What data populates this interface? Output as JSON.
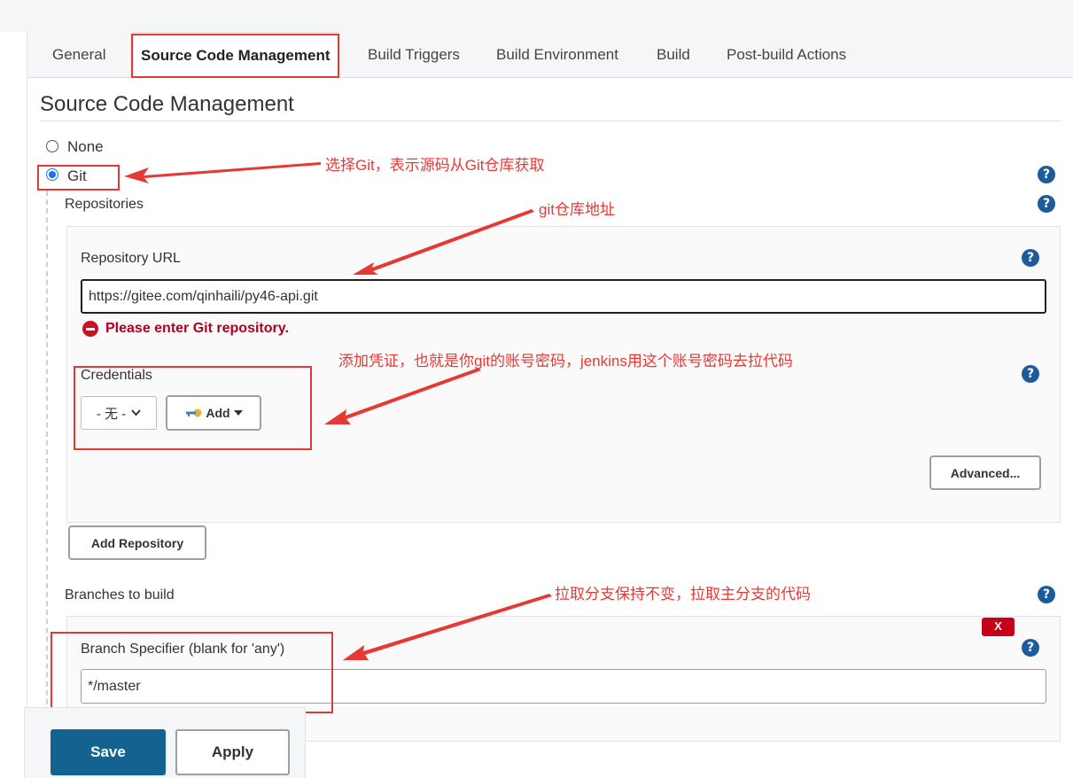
{
  "tabs": [
    {
      "label": "General"
    },
    {
      "label": "Source Code Management"
    },
    {
      "label": "Build Triggers"
    },
    {
      "label": "Build Environment"
    },
    {
      "label": "Build"
    },
    {
      "label": "Post-build Actions"
    }
  ],
  "section_title": "Source Code Management",
  "scm_options": {
    "none_label": "None",
    "git_label": "Git",
    "selected": "Git"
  },
  "repositories": {
    "heading": "Repositories",
    "url_label": "Repository URL",
    "url_value": "https://gitee.com/qinhaili/py46-api.git",
    "error_text": "Please enter Git repository.",
    "credentials_label": "Credentials",
    "credentials_selected": "- 无 -",
    "add_button": "Add",
    "advanced_button": "Advanced...",
    "add_repository_button": "Add Repository"
  },
  "branches": {
    "heading": "Branches to build",
    "specifier_label": "Branch Specifier (blank for 'any')",
    "specifier_value": "*/master",
    "delete_button": "X"
  },
  "footer": {
    "save_label": "Save",
    "apply_label": "Apply"
  },
  "help_glyph": "?",
  "annotations": {
    "git_note": "选择Git，表示源码从Git仓库获取",
    "url_note": "git仓库地址",
    "credentials_note": "添加凭证，也就是你git的账号密码，jenkins用这个账号密码去拉代码",
    "branch_note": "拉取分支保持不变，拉取主分支的代码"
  },
  "colors": {
    "annotation_red": "#e53935",
    "help_blue": "#1d5b9a",
    "save_blue": "#14628f",
    "error_red": "#b00020"
  }
}
